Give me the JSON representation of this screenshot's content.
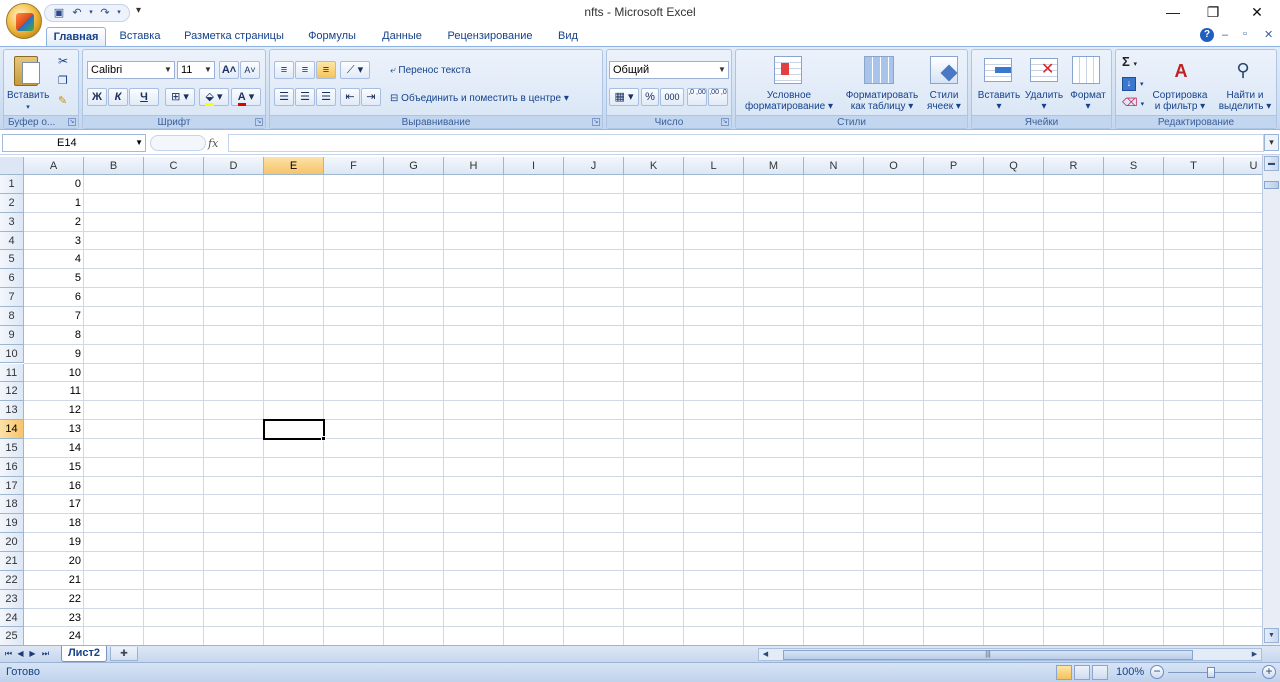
{
  "window": {
    "title": "nfts - Microsoft Excel",
    "minimize_glyph": "—",
    "restore_glyph": "❐",
    "close_glyph": "✕",
    "help_glyph": "?",
    "doc_min_glyph": "–",
    "doc_restore_glyph": "▫",
    "doc_close_glyph": "✕"
  },
  "qat": {
    "save_icon": "save-icon",
    "undo_icon": "undo-icon",
    "redo_icon": "redo-icon",
    "more": "▾"
  },
  "tabs": [
    "Главная",
    "Вставка",
    "Разметка страницы",
    "Формулы",
    "Данные",
    "Рецензирование",
    "Вид"
  ],
  "active_tab": "Главная",
  "ribbon": {
    "clipboard": {
      "label": "Буфер о...",
      "paste": "Вставить"
    },
    "font": {
      "label": "Шрифт",
      "font_name": "Calibri",
      "font_size": "11",
      "bold": "Ж",
      "italic": "К",
      "underline": "Ч",
      "grow": "A˄",
      "shrink": "A˅"
    },
    "alignment": {
      "label": "Выравнивание",
      "wrap": "Перенос текста",
      "merge": "Объединить и поместить в центре"
    },
    "number": {
      "label": "Число",
      "format": "Общий",
      "percent": "%",
      "thousands": "000",
      "inc_dec": ",0 ,00",
      "dec_dec": ",00 ,0"
    },
    "styles": {
      "label": "Стили",
      "conditional": [
        "Условное",
        "форматирование"
      ],
      "as_table": [
        "Форматировать",
        "как таблицу"
      ],
      "cell_styles": [
        "Стили",
        "ячеек"
      ]
    },
    "cells": {
      "label": "Ячейки",
      "insert": "Вставить",
      "delete": "Удалить",
      "format": "Формат"
    },
    "editing": {
      "label": "Редактирование",
      "sigma": "Σ",
      "sort": [
        "Сортировка",
        "и фильтр"
      ],
      "find": [
        "Найти и",
        "выделить"
      ]
    }
  },
  "formula_bar": {
    "name_box": "E14",
    "fx": "fx",
    "formula": ""
  },
  "columns": [
    "A",
    "B",
    "C",
    "D",
    "E",
    "F",
    "G",
    "H",
    "I",
    "J",
    "K",
    "L",
    "M",
    "N",
    "O",
    "P",
    "Q",
    "R",
    "S",
    "T",
    "U"
  ],
  "selected_column": "E",
  "selected_row": 14,
  "rows": [
    {
      "n": "1",
      "a": "0"
    },
    {
      "n": "2",
      "a": "1"
    },
    {
      "n": "3",
      "a": "2"
    },
    {
      "n": "4",
      "a": "3"
    },
    {
      "n": "5",
      "a": "4"
    },
    {
      "n": "6",
      "a": "5"
    },
    {
      "n": "7",
      "a": "6"
    },
    {
      "n": "8",
      "a": "7"
    },
    {
      "n": "9",
      "a": "8"
    },
    {
      "n": "10",
      "a": "9"
    },
    {
      "n": "11",
      "a": "10"
    },
    {
      "n": "12",
      "a": "11"
    },
    {
      "n": "13",
      "a": "12"
    },
    {
      "n": "14",
      "a": "13"
    },
    {
      "n": "15",
      "a": "14"
    },
    {
      "n": "16",
      "a": "15"
    },
    {
      "n": "17",
      "a": "16"
    },
    {
      "n": "18",
      "a": "17"
    },
    {
      "n": "19",
      "a": "18"
    },
    {
      "n": "20",
      "a": "19"
    },
    {
      "n": "21",
      "a": "20"
    },
    {
      "n": "22",
      "a": "21"
    },
    {
      "n": "23",
      "a": "22"
    },
    {
      "n": "24",
      "a": "23"
    },
    {
      "n": "25",
      "a": "24"
    }
  ],
  "sheet_tabs": [
    "Лист2"
  ],
  "status": {
    "text": "Готово",
    "zoom": "100%",
    "zoom_minus": "−",
    "zoom_plus": "+"
  }
}
